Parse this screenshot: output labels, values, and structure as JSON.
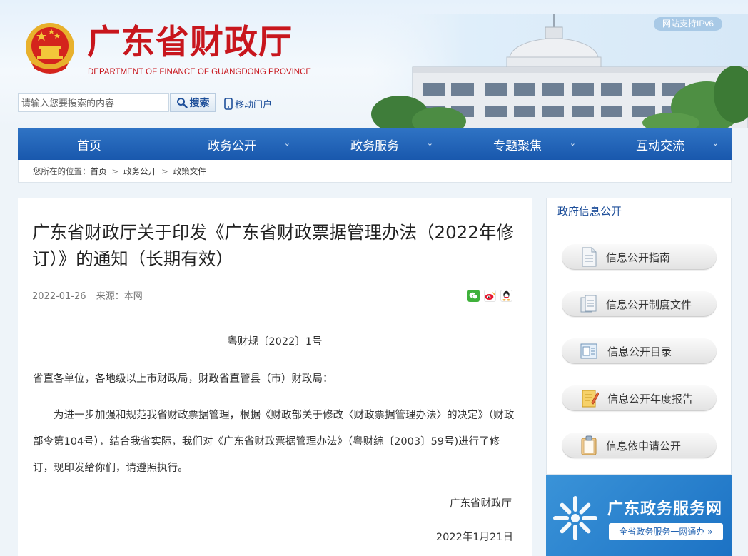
{
  "header": {
    "title_cn": "广东省财政厅",
    "title_en": "DEPARTMENT OF FINANCE OF GUANGDONG PROVINCE",
    "ipv6_badge": "网站支持IPv6",
    "search": {
      "placeholder": "请输入您要搜索的内容",
      "button_label": "搜索"
    },
    "mobile_link": "移动门户"
  },
  "nav": {
    "items": [
      {
        "label": "首页"
      },
      {
        "label": "政务公开"
      },
      {
        "label": "政务服务"
      },
      {
        "label": "专题聚焦"
      },
      {
        "label": "互动交流"
      }
    ]
  },
  "breadcrumb": {
    "prefix": "您所在的位置：",
    "items": [
      "首页",
      "政务公开",
      "政策文件"
    ],
    "separator": ">"
  },
  "article": {
    "title": "广东省财政厅关于印发《广东省财政票据管理办法（2022年修订）》的通知（长期有效）",
    "date": "2022-01-26",
    "source": "来源：本网",
    "doc_number": "粤财规〔2022〕1号",
    "addressee": "省直各单位，各地级以上市财政局，财政省直管县（市）财政局：",
    "body": "为进一步加强和规范我省财政票据管理，根据《财政部关于修改〈财政票据管理办法〉的决定》（财政部令第104号），结合我省实际，我们对《广东省财政票据管理办法》（粤财综〔2003〕59号)进行了修订，现印发给你们，请遵照执行。",
    "signature_org": "广东省财政厅",
    "signature_date": "2022年1月21日",
    "share_icons": [
      "wechat-icon",
      "weibo-icon",
      "qq-icon"
    ]
  },
  "sidebar": {
    "title": "政府信息公开",
    "items": [
      {
        "label": "信息公开指南",
        "icon": "document-icon"
      },
      {
        "label": "信息公开制度文件",
        "icon": "documents-icon"
      },
      {
        "label": "信息公开目录",
        "icon": "catalog-icon"
      },
      {
        "label": "信息公开年度报告",
        "icon": "report-icon"
      },
      {
        "label": "信息依申请公开",
        "icon": "clipboard-icon"
      }
    ]
  },
  "banner": {
    "title": "广东政务服务网",
    "subtitle": "全省政务服务一网通办 »"
  },
  "colors": {
    "brand_red": "#c8161d",
    "nav_blue": "#1958ad",
    "link_blue": "#1e4f9a",
    "banner_blue": "#1c72c4"
  }
}
